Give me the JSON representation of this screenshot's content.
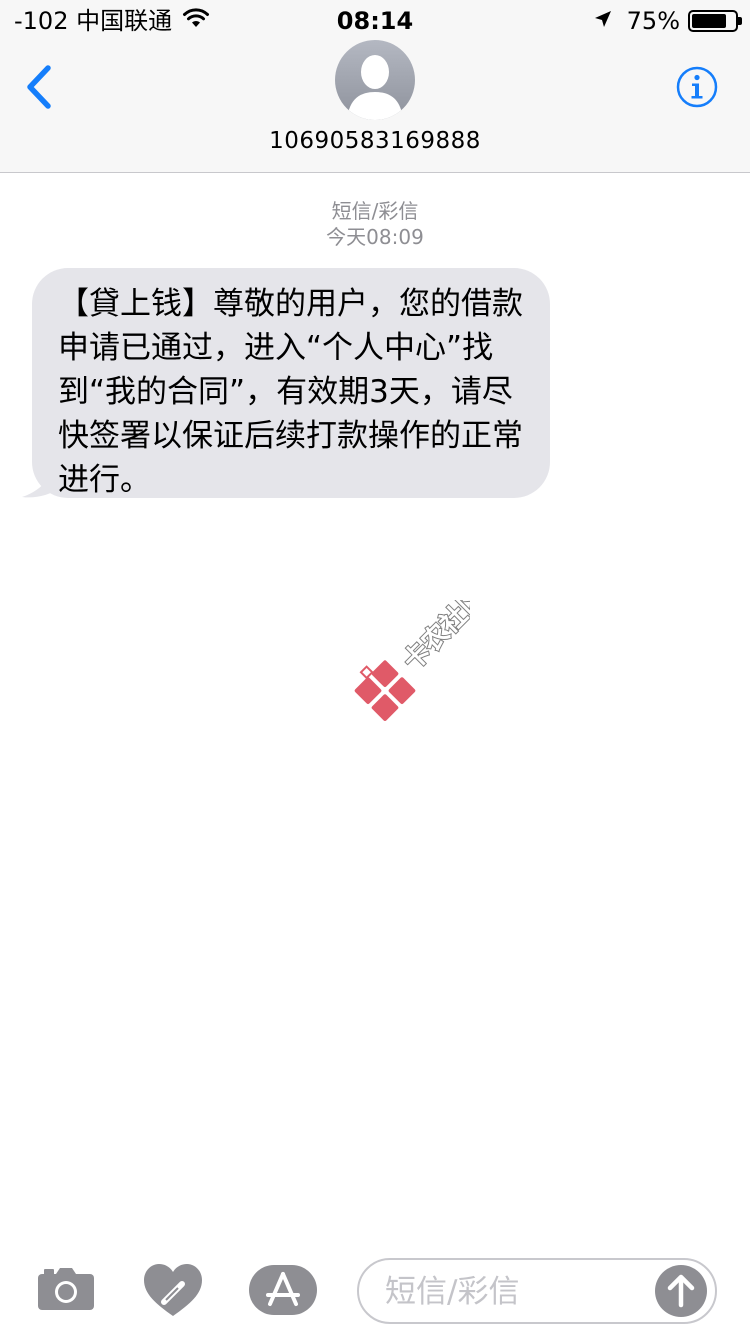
{
  "status_bar": {
    "carrier": "-102 中国联通",
    "time": "08:14",
    "battery_percent": "75%",
    "battery_level": 0.75,
    "icons": [
      "wifi-icon",
      "location-arrow-icon",
      "battery-icon"
    ]
  },
  "header": {
    "contact": "10690583169888",
    "icons": [
      "chevron-left-icon",
      "person-silhouette-icon",
      "info-icon"
    ],
    "accent_color": "#157efb"
  },
  "conversation": {
    "message_type": "短信/彩信",
    "timestamp": "今天08:09",
    "messages": [
      {
        "direction": "incoming",
        "text": "【貸上钱】尊敬的用户，您的借款申请已通过，进入“个人中心”找到“我的合同”，有效期3天，请尽快签署以保证后续打款操作的正常进行。",
        "bubble_color": "#e5e5ea"
      }
    ]
  },
  "watermark": {
    "text": "卡农社区",
    "icon": "gift-logo-icon",
    "color": "#e05a68"
  },
  "input_bar": {
    "placeholder": "短信/彩信",
    "icons": [
      "camera-icon",
      "digital-touch-heart-icon",
      "app-store-icon",
      "send-arrow-icon"
    ],
    "icon_color": "#8e8e93"
  }
}
